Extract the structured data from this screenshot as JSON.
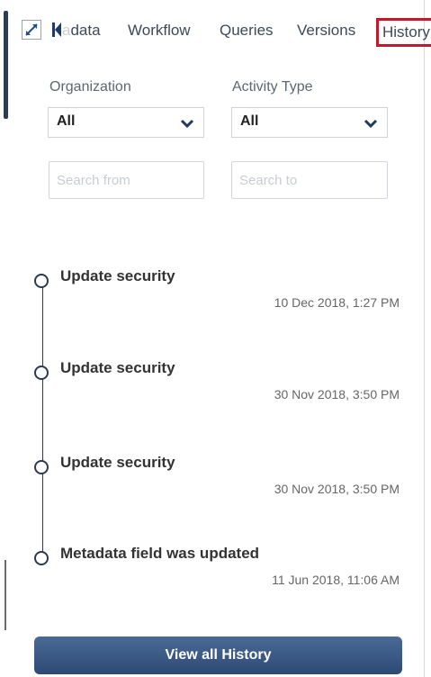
{
  "tabs": {
    "metadata_label_faded": "a",
    "metadata_label": "data",
    "workflow_label": "Workflow",
    "queries_label": "Queries",
    "versions_label": "Versions",
    "history_label": "History"
  },
  "filters": {
    "organization_label": "Organization",
    "organization_value": "All",
    "activity_type_label": "Activity Type",
    "activity_type_value": "All",
    "search_from_placeholder": "Search from",
    "search_to_placeholder": "Search to"
  },
  "history": [
    {
      "title": "Update security",
      "time": "10 Dec 2018, 1:27 PM"
    },
    {
      "title": "Update security",
      "time": "30 Nov 2018, 3:50 PM"
    },
    {
      "title": "Update security",
      "time": "30 Nov 2018, 3:50 PM"
    },
    {
      "title": "Metadata field was updated",
      "time": "11 Jun 2018, 11:06 AM"
    }
  ],
  "view_all_label": "View all History",
  "colors": {
    "accent": "#2d4a74",
    "highlight_box": "#c21a2a",
    "timeline": "#2b3a4f"
  },
  "icons": [
    "expand-icon",
    "previous-tab-icon",
    "chevron-down-icon"
  ]
}
